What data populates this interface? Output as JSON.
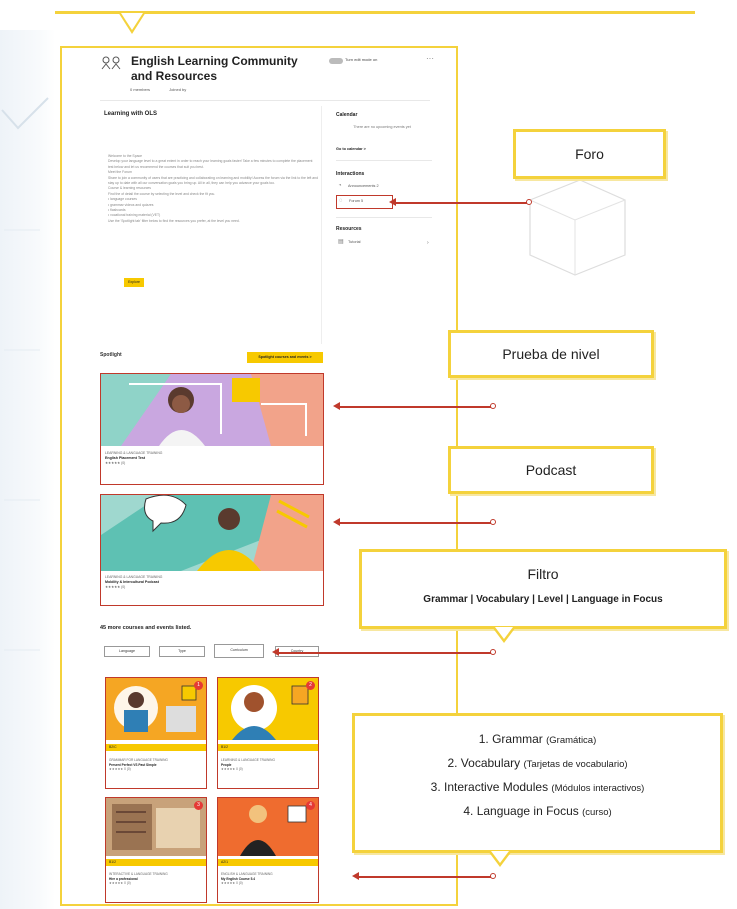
{
  "header": {
    "title": "English Learning Community and Resources",
    "members": "0 members",
    "joined": "Joined by",
    "toggle_label": "Turn edit mode on",
    "more": "···"
  },
  "learning": {
    "title": "Learning with OLS",
    "body": "Welcome to the Space\nDevelop your language level to a great extent in order to reach your learning goals faster! Take a few minutes to complete the placement test below and let us recommend the courses that suit you best.\nMeet the Forum\nShare to join a community of users that are practicing and collaborating on learning and mobility! Access the forum via the link to the left and stay up to date with all our conversation goals you bring up. All in all, they can help you advance your goals too.\nCourse & learning resources\nFind the of detail the course by selecting the level and check the fit you.\n• language courses\n• grammar videos and quizzes\n• flashcards\n• vocational training material (VET)\nUse the 'Spotlight tab' filter below to find the resources you prefer, at the level you need.",
    "button": "Explore"
  },
  "calendar": {
    "title": "Calendar",
    "message": "There are no upcoming events yet",
    "link": "Go to calendar  >"
  },
  "interactions": {
    "title": "Interactions",
    "items": [
      {
        "label": "Announcements 2",
        "icon": "megaphone-icon"
      },
      {
        "label": "Forum 5",
        "icon": "chat-icon"
      }
    ]
  },
  "resources": {
    "title": "Resources",
    "items": [
      {
        "label": "Tutorial",
        "icon": "document-icon"
      }
    ]
  },
  "spotlight": {
    "title": "Spotlight",
    "button": "Spotlight courses and events  >",
    "cards": [
      {
        "meta": "LEARNING & LANGUAGE TRAINING",
        "title": "English Placement Test",
        "rating": "★★★★★ (0)"
      },
      {
        "meta": "LEARNING & LANGUAGE TRAINING",
        "title": "Mobility & Intercultural Podcast",
        "rating": "★★★★★ (0)"
      }
    ]
  },
  "listing": {
    "title": "45 more courses and events listed.",
    "filters": [
      "Language",
      "Type",
      "Curriculum",
      "Country"
    ]
  },
  "grid_cards": [
    {
      "num": "1",
      "tag": "B2/C",
      "meta": "GRAMMAR FOR LANGUAGE TRAINING",
      "title": "Present Perfect VS Past Simple",
      "rating": "★★★★★ 0 (0)",
      "bg": "#f5a623"
    },
    {
      "num": "2",
      "tag": "B1/2",
      "meta": "LEARNING & LANGUAGE TRAINING",
      "title": "People",
      "rating": "★★★★★ 0 (0)",
      "bg": "#f7c900"
    },
    {
      "num": "3",
      "tag": "B1/2",
      "meta": "INTERACTIVE & LANGUAGE TRAINING",
      "title": "Hire a professional",
      "rating": "★★★★★ 0 (0)",
      "bg": "#c8a27a"
    },
    {
      "num": "4",
      "tag": "A2/1",
      "meta": "ENGLISH & LANGUAGE TRAINING",
      "title": "My English Course 5.4",
      "rating": "★★★★★ 0 (0)",
      "bg": "#ef6c2f"
    }
  ],
  "callouts": {
    "foro": "Foro",
    "prueba": "Prueba de nivel",
    "podcast": "Podcast",
    "filtro_title": "Filtro",
    "filtro_items": "Grammar | Vocabulary | Level | Language in Focus",
    "list": [
      {
        "num": "1.",
        "main": "Grammar",
        "sub": "(Gramática)"
      },
      {
        "num": "2.",
        "main": "Vocabulary",
        "sub": "(Tarjetas de vocabulario)"
      },
      {
        "num": "3.",
        "main": "Interactive Modules",
        "sub": "(Módulos interactivos)"
      },
      {
        "num": "4.",
        "main": "Language in Focus",
        "sub": "(curso)"
      }
    ]
  },
  "colors": {
    "accent": "#f4d23c",
    "button": "#f7c900",
    "highlight": "#c0392b"
  }
}
